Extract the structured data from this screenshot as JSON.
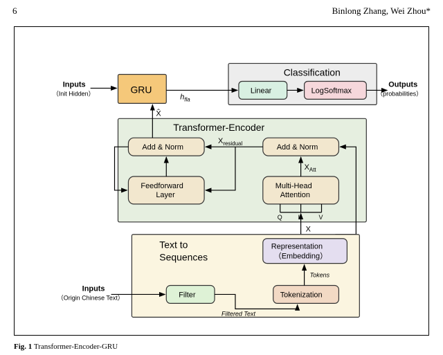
{
  "header": {
    "page_num": "6",
    "authors": "Binlong Zhang, Wei Zhou*"
  },
  "caption": {
    "label": "Fig. 1",
    "text": "Transformer-Encoder-GRU"
  },
  "groups": {
    "classification": "Classification",
    "transformer": "Transformer-Encoder",
    "text2seq": "Text to\nSequences"
  },
  "blocks": {
    "gru": "GRU",
    "linear": "Linear",
    "logsoftmax": "LogSoftmax",
    "addnorm1": "Add & Norm",
    "addnorm2": "Add & Norm",
    "ff": "Feedforward\nLayer",
    "mha": "Multi-Head\nAttention",
    "repr": "Representation\n（Embedding）",
    "tokenization": "Tokenization",
    "filter": "Filter"
  },
  "labels": {
    "inputs_top": "Inputs",
    "init_hidden": "（Init Hidden）",
    "outputs": "Outputs",
    "probs": "（probabilities）",
    "inputs_bottom": "Inputs",
    "origin": "（Origin Chinese Text）",
    "hfla": "h",
    "hfla_sub": "fla",
    "xhat": "X̂",
    "xres": "X",
    "xres_sub": "residual",
    "xatt": "X",
    "xatt_sub": "Att",
    "x": "X",
    "q": "Q",
    "k": "K",
    "v": "V",
    "tokens": "Tokens",
    "filtered": "Filtered Text"
  },
  "colors": {
    "gru": "#f5c87a",
    "gru_border": "#c9a14a",
    "class_bg": "#ededed",
    "class_border": "#888",
    "linear": "#d8f0e2",
    "linear_border": "#5aa97e",
    "logsoft": "#f6d7db",
    "logsoft_border": "#c77887",
    "trans_bg": "#e6efe0",
    "trans_border": "#8fa97e",
    "sub_bg": "#f2e7ce",
    "sub_border": "#b89e69",
    "t2s_bg": "#fbf5e0",
    "t2s_border": "#c8b36a",
    "filter": "#def2d6",
    "filter_border": "#7fb772",
    "purple": "#e4def0",
    "purple_border": "#a493c6",
    "token": "#f2d9c4",
    "token_border": "#c49870"
  }
}
